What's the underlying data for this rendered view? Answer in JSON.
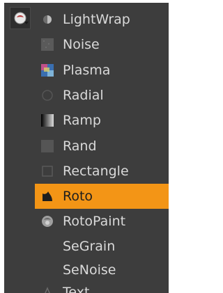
{
  "menu": {
    "items": [
      {
        "label": "LightWrap",
        "icon": "lightwrap-icon"
      },
      {
        "label": "Noise",
        "icon": "noise-icon"
      },
      {
        "label": "Plasma",
        "icon": "plasma-icon"
      },
      {
        "label": "Radial",
        "icon": "radial-icon"
      },
      {
        "label": "Ramp",
        "icon": "ramp-icon"
      },
      {
        "label": "Rand",
        "icon": "rand-icon"
      },
      {
        "label": "Rectangle",
        "icon": "rectangle-icon"
      },
      {
        "label": "Roto",
        "icon": "roto-icon",
        "selected": true
      },
      {
        "label": "RotoPaint",
        "icon": "rotopaint-icon"
      },
      {
        "label": "SeGrain",
        "icon": ""
      },
      {
        "label": "SeNoise",
        "icon": ""
      },
      {
        "label": "Text",
        "icon": "text-icon"
      }
    ]
  },
  "colors": {
    "background": "#3d3d3d",
    "selected": "#f39516",
    "text": "#d9d9d9"
  }
}
